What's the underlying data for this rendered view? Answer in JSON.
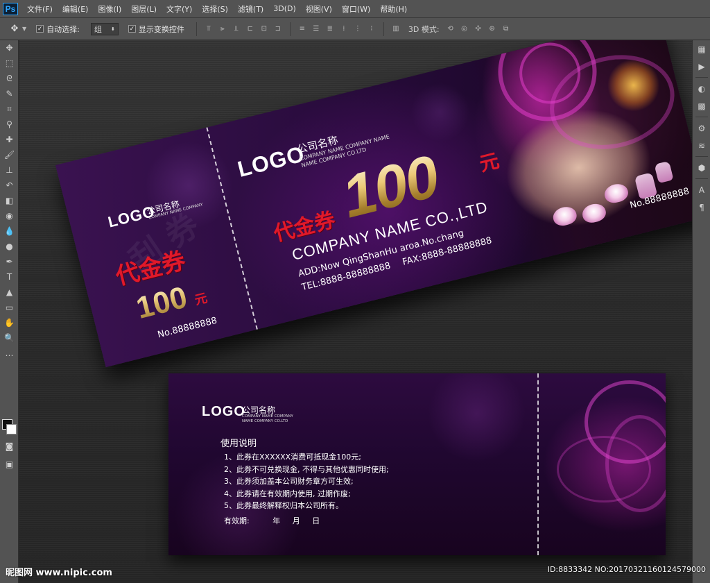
{
  "app": {
    "logo": "Ps"
  },
  "menu": {
    "items": [
      "文件(F)",
      "编辑(E)",
      "图像(I)",
      "图层(L)",
      "文字(Y)",
      "选择(S)",
      "滤镜(T)",
      "3D(D)",
      "视图(V)",
      "窗口(W)",
      "帮助(H)"
    ]
  },
  "options": {
    "auto_select_label": "自动选择:",
    "auto_select_value": "组",
    "show_transform_label": "显示变换控件",
    "mode_3d_label": "3D 模式:"
  },
  "front": {
    "stub": {
      "logo": "LOGO",
      "logo_cn": "公司名称",
      "logo_sub": "COMPANY NAME COMPANY",
      "voucher": "代金券",
      "amount": "100",
      "unit": "元",
      "number": "No.88888888"
    },
    "main": {
      "logo": "LOGO",
      "logo_cn": "公司名称",
      "logo_sub1": "COMPANY NAME COMPANY NAME",
      "logo_sub2": "NAME COMPANY CO.LTD",
      "voucher": "代金券",
      "amount": "100",
      "unit": "元",
      "company": "COMPANY NAME CO.,LTD",
      "address": "ADD:Now QingShanHu aroa.No.chang",
      "tel": "TEL:8888-88888888",
      "fax": "FAX:8888-88888888",
      "number": "No.88888888"
    }
  },
  "back": {
    "logo": "LOGO",
    "logo_cn": "公司名称",
    "logo_sub1": "COMPANY NAME COMPANY",
    "logo_sub2": "NAME COMPANY CO.LTD",
    "usage_title": "使用说明",
    "rules": [
      "1、此券在XXXXXX消费可抵现金100元;",
      "2、此券不可兑换现金, 不得与其他优惠同时使用;",
      "3、此券须加盖本公司财务章方可生效;",
      "4、此券请在有效期内使用, 过期作废;",
      "5、此券最终解释权归本公司所有。"
    ],
    "validity_label": "有效期:",
    "year": "年",
    "month": "月",
    "day": "日"
  },
  "watermark": {
    "site": "昵图网 www.nipic.com",
    "id": "ID:8833342 NO:20170321160124579000"
  }
}
